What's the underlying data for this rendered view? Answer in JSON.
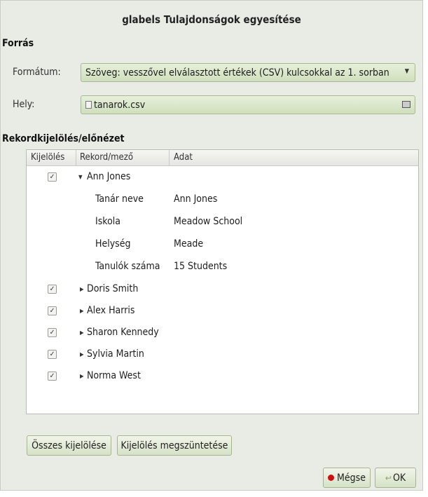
{
  "window": {
    "title": "glabels Tulajdonságok egyesítése"
  },
  "source": {
    "section_label": "Forrás",
    "format_label": "Formátum:",
    "format_value": "Szöveg: vesszővel elválasztott értékek (CSV) kulcsokkal az 1. sorban",
    "location_label": "Hely:",
    "location_value": "tanarok.csv"
  },
  "records": {
    "section_label": "Rekordkijelölés/előnézet",
    "columns": [
      "Kijelölés",
      "Rekord/mező",
      "Adat"
    ],
    "expanded": {
      "name": "Ann Jones",
      "fields": [
        {
          "field": "Tanár neve",
          "value": "Ann Jones"
        },
        {
          "field": "Iskola",
          "value": "Meadow School"
        },
        {
          "field": "Helység",
          "value": "Meade"
        },
        {
          "field": "Tanulók száma",
          "value": "15 Students"
        }
      ]
    },
    "collapsed": [
      "Doris Smith",
      "Alex Harris",
      "Sharon Kennedy",
      "Sylvia Martin",
      "Norma West"
    ]
  },
  "buttons": {
    "select_all": "Összes kijelölése",
    "unselect_all": "Kijelölés megszüntetése",
    "cancel": "Mégse",
    "ok": "OK"
  },
  "icons": {
    "check": "check-icon",
    "expander_open": "triangle-down-icon",
    "expander_closed": "triangle-right-icon"
  }
}
